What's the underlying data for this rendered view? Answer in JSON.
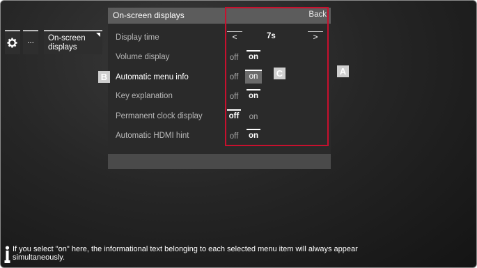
{
  "breadcrumb": {
    "more_label": "...",
    "current_label_line1": "On-screen",
    "current_label_line2": "displays"
  },
  "menu": {
    "title": "On-screen displays",
    "back_label": "Back",
    "display_time": {
      "label": "Display time",
      "prev": "<",
      "value": "7s",
      "next": ">"
    },
    "rows": [
      {
        "label": "Volume display",
        "off": "off",
        "on": "on",
        "selected": "on"
      },
      {
        "label": "Automatic menu info",
        "off": "off",
        "on": "on",
        "selected": "on"
      },
      {
        "label": "Key explanation",
        "off": "off",
        "on": "on",
        "selected": "on"
      },
      {
        "label": "Permanent clock display",
        "off": "off",
        "on": "on",
        "selected": "off"
      },
      {
        "label": "Automatic HDMI hint",
        "off": "off",
        "on": "on",
        "selected": "on"
      }
    ]
  },
  "callouts": {
    "a": "A",
    "b": "B",
    "c": "C"
  },
  "info": {
    "line1": "If you select \"on\" here, the informational text belonging to each selected menu item will always appear",
    "line2": "simultaneously."
  },
  "colors": {
    "highlight_frame": "#c8102e",
    "panel_header": "#5c5c5c",
    "focused_option": "#6b6b6b"
  }
}
